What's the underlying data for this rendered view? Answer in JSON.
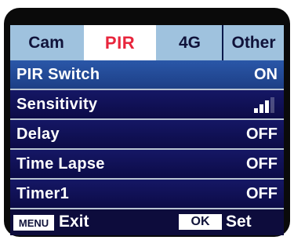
{
  "tabs": [
    {
      "label": "Cam"
    },
    {
      "label": "PIR",
      "active": true
    },
    {
      "label": "4G"
    },
    {
      "label": "Other"
    }
  ],
  "rows": [
    {
      "label": "PIR Switch",
      "value": "ON"
    },
    {
      "label": "Sensitivity",
      "value_icon": "signal-bars-icon",
      "level_bars": 3,
      "max_bars": 4
    },
    {
      "label": "Delay",
      "value": "OFF"
    },
    {
      "label": "Time Lapse",
      "value": "OFF"
    },
    {
      "label": "Timer1",
      "value": "OFF"
    }
  ],
  "footer": {
    "menu_key": "MENU",
    "exit_label": "Exit",
    "ok_key": "OK",
    "set_label": "Set"
  },
  "colors": {
    "tab_bar": "#9fc2de",
    "active_tab_text": "#e8253c",
    "selected_row": "#2a57a8",
    "screen_background": "#0d0c3c"
  }
}
